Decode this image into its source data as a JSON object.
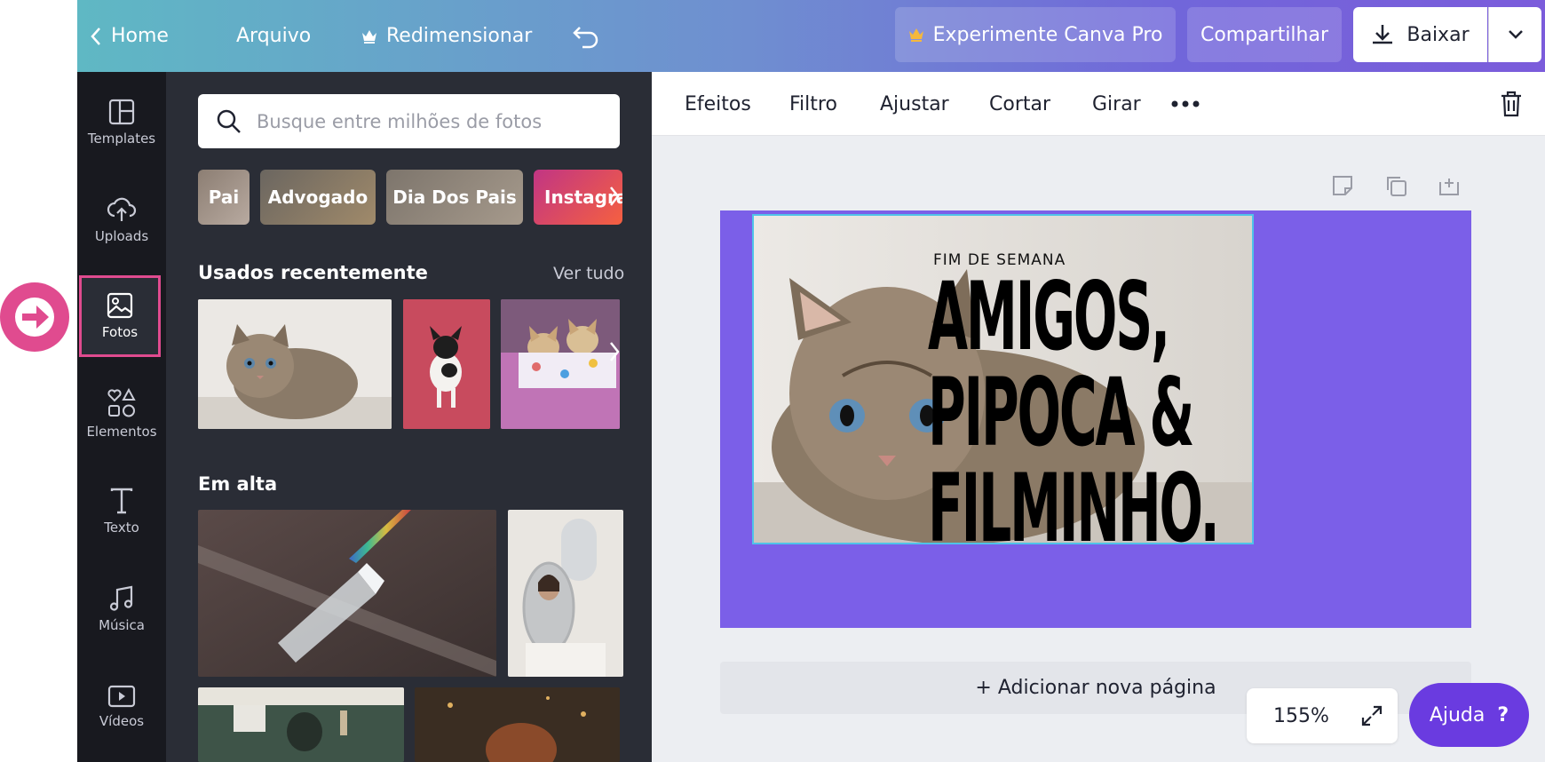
{
  "topbar": {
    "home_label": "Home",
    "file_label": "Arquivo",
    "resize_label": "Redimensionar",
    "pro_label": "Experimente Canva Pro",
    "share_label": "Compartilhar",
    "download_label": "Baixar"
  },
  "rail": {
    "items": [
      {
        "label": "Templates",
        "icon": "templates-icon"
      },
      {
        "label": "Uploads",
        "icon": "cloud-upload-icon"
      },
      {
        "label": "Fotos",
        "icon": "photo-icon"
      },
      {
        "label": "Elementos",
        "icon": "shapes-icon"
      },
      {
        "label": "Texto",
        "icon": "text-icon"
      },
      {
        "label": "Música",
        "icon": "music-icon"
      },
      {
        "label": "Vídeos",
        "icon": "video-icon"
      }
    ],
    "active": "Fotos"
  },
  "panel": {
    "search_placeholder": "Busque entre milhões de fotos",
    "chips": [
      "Pai",
      "Advogado",
      "Dia Dos Pais",
      "Instagram"
    ],
    "recent_title": "Usados recentemente",
    "see_all": "Ver tudo",
    "trending_title": "Em alta"
  },
  "editor_toolbar": {
    "items": [
      "Efeitos",
      "Filtro",
      "Ajustar",
      "Cortar",
      "Girar"
    ]
  },
  "design": {
    "small_text": "FIM DE SEMANA",
    "line1": "AMIGOS,",
    "line2": "PIPOCA &",
    "line3": "FILMINHO."
  },
  "canvas": {
    "add_page_label": "+ Adicionar nova página",
    "zoom": "155%",
    "help_label": "Ajuda",
    "help_mark": "?"
  },
  "colors": {
    "accent_pink": "#e04b8f",
    "design_bg": "#7b5fe8",
    "help_bg": "#6a3be0"
  }
}
